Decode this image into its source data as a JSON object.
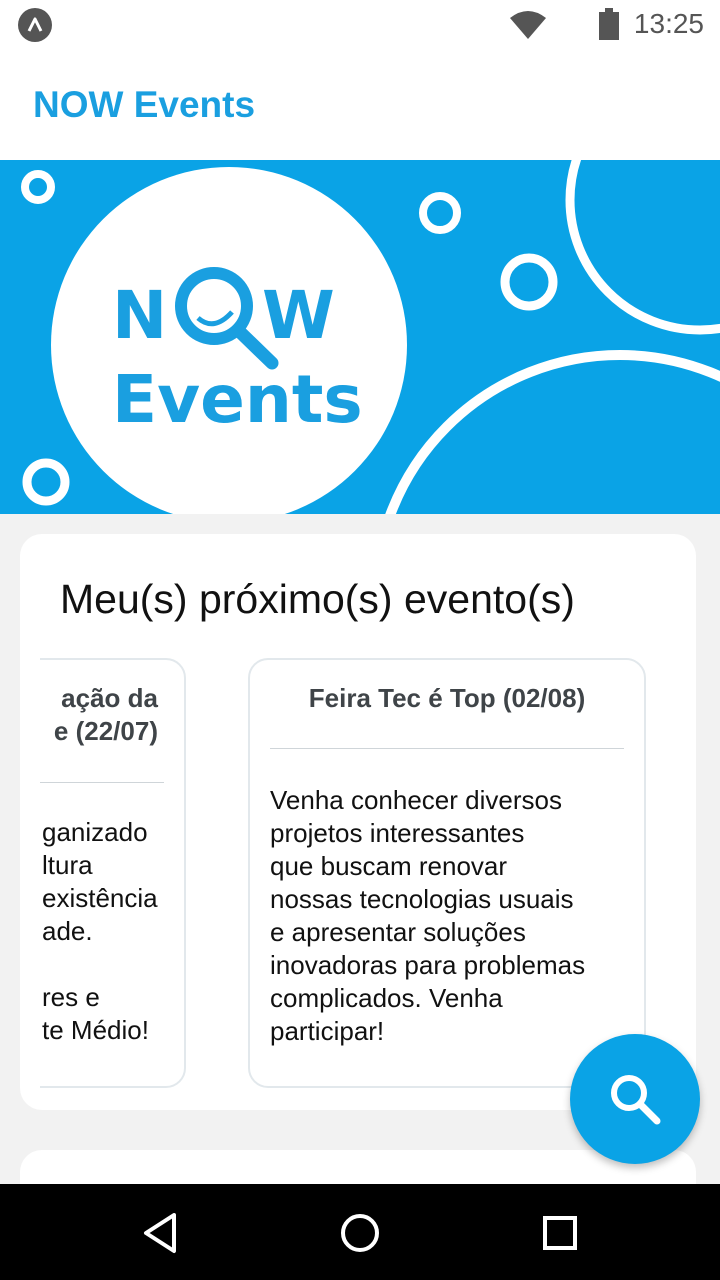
{
  "status_bar": {
    "time": "13:25",
    "icons": [
      "app-launcher-icon",
      "wifi-icon",
      "battery-icon"
    ]
  },
  "app_bar": {
    "title": "NOW Events"
  },
  "banner": {
    "logo_text": "NOW Events",
    "logo_line1_prefix": "N",
    "logo_line1_suffix": "W",
    "logo_line2": "Events",
    "background_color": "#0aa3e6"
  },
  "upcoming": {
    "title": "Meu(s) próximo(s) evento(s)",
    "events": [
      {
        "title_line1": "ação da",
        "title_line2": "e (22/07)",
        "description": "ganizado\nltura\nexistência\nade.\n\nres e\nte Médio!"
      },
      {
        "title": "Feira Tec é Top (02/08)",
        "description": "Venha conhecer diversos\nprojetos interessantes\nque buscam renovar\nnossas tecnologias usuais\ne apresentar soluções\ninovadoras para problemas\ncomplicados. Venha\nparticipar!"
      }
    ]
  },
  "fab": {
    "icon": "search-icon"
  },
  "nav_bar": {
    "icons": [
      "back-icon",
      "home-icon",
      "recents-icon"
    ]
  },
  "colors": {
    "accent": "#1a9fe0",
    "banner": "#0aa3e6"
  }
}
